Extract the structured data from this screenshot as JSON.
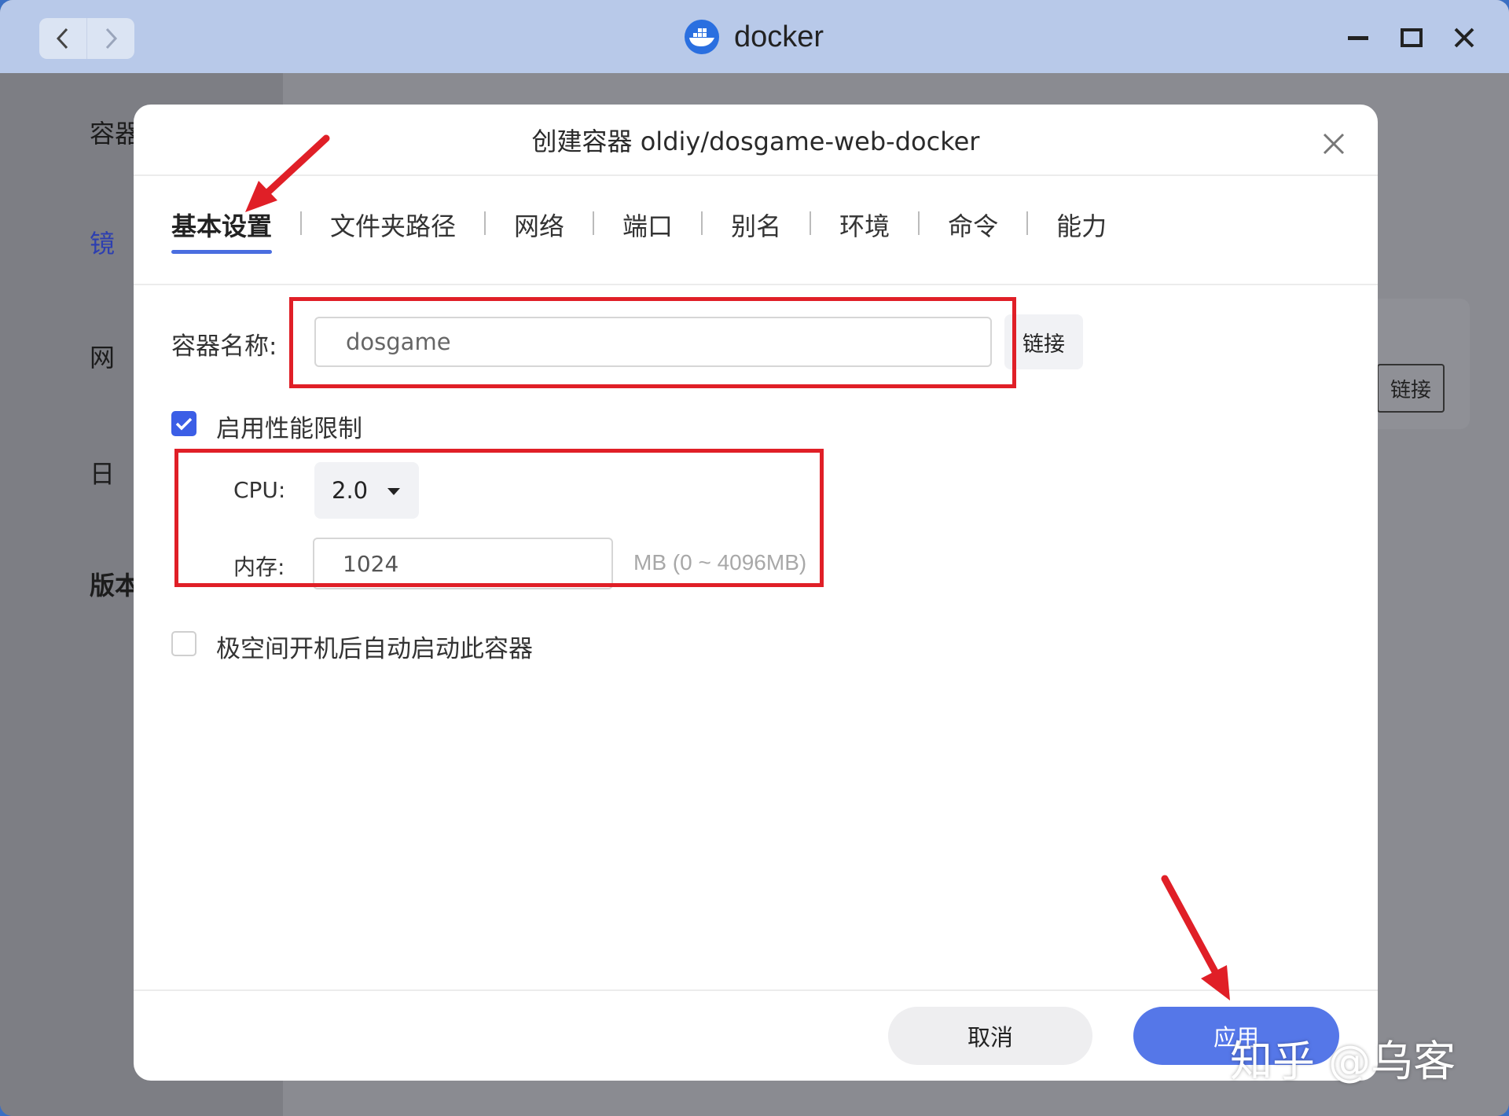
{
  "window": {
    "app_title": "docker",
    "icons": [
      "back-icon",
      "forward-icon",
      "docker-logo-icon",
      "minimize-icon",
      "maximize-icon",
      "close-icon"
    ]
  },
  "background": {
    "sidebar_items": [
      "容器",
      "镜",
      "网",
      "日",
      "版本"
    ],
    "link_button": "链接"
  },
  "dialog": {
    "title": "创建容器 oldiy/dosgame-web-docker",
    "tabs": [
      "基本设置",
      "文件夹路径",
      "网络",
      "端口",
      "别名",
      "环境",
      "命令",
      "能力"
    ],
    "active_tab": "基本设置",
    "container_name_label": "容器名称:",
    "container_name_value": "dosgame",
    "link_button": "链接",
    "perf_limit_label": "启用性能限制",
    "perf_limit_checked": true,
    "cpu_label": "CPU:",
    "cpu_value": "2.0",
    "memory_label": "内存:",
    "memory_value": "1024",
    "memory_hint": "MB (0 ~ 4096MB)",
    "autostart_label": "极空间开机后自动启动此容器",
    "autostart_checked": false,
    "cancel_button": "取消",
    "apply_button": "应用"
  },
  "annotation_colors": {
    "highlight_red": "#e01f27",
    "accent_blue": "#4a6ee0"
  },
  "watermark": "知乎 @乌客"
}
